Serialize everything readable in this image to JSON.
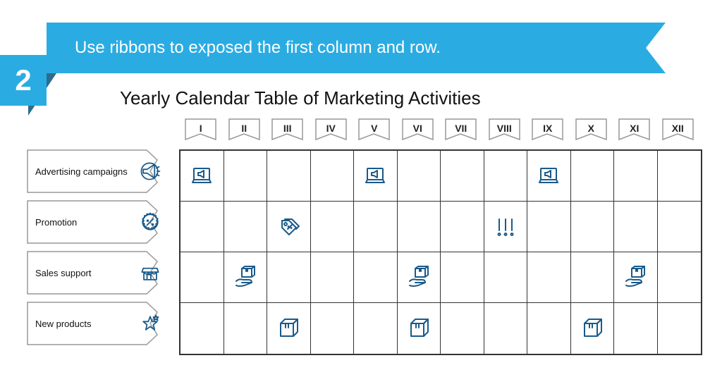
{
  "banner": {
    "text": "Use ribbons to exposed the first column and row.",
    "number": "2"
  },
  "subtitle": "Yearly Calendar Table of Marketing Activities",
  "columns": [
    "I",
    "II",
    "III",
    "IV",
    "V",
    "VI",
    "VII",
    "VIII",
    "IX",
    "X",
    "XI",
    "XII"
  ],
  "rows": [
    {
      "label": "Advertising campaigns",
      "icon": "megaphone"
    },
    {
      "label": "Promotion",
      "icon": "discount"
    },
    {
      "label": "Sales support",
      "icon": "storefront"
    },
    {
      "label": "New products",
      "icon": "star"
    }
  ],
  "cells": [
    {
      "row": 0,
      "col": 0,
      "icon": "laptop-megaphone"
    },
    {
      "row": 0,
      "col": 4,
      "icon": "laptop-megaphone"
    },
    {
      "row": 0,
      "col": 8,
      "icon": "laptop-megaphone"
    },
    {
      "row": 1,
      "col": 2,
      "icon": "price-tags"
    },
    {
      "row": 1,
      "col": 7,
      "icon": "exclaim"
    },
    {
      "row": 2,
      "col": 1,
      "icon": "hand-box"
    },
    {
      "row": 2,
      "col": 5,
      "icon": "hand-box"
    },
    {
      "row": 2,
      "col": 10,
      "icon": "hand-box"
    },
    {
      "row": 3,
      "col": 2,
      "icon": "box"
    },
    {
      "row": 3,
      "col": 5,
      "icon": "box"
    },
    {
      "row": 3,
      "col": 9,
      "icon": "box"
    }
  ],
  "colors": {
    "accent": "#2aace2",
    "accentDark": "#2a6d8e",
    "iconStroke": "#1a5a8a"
  }
}
